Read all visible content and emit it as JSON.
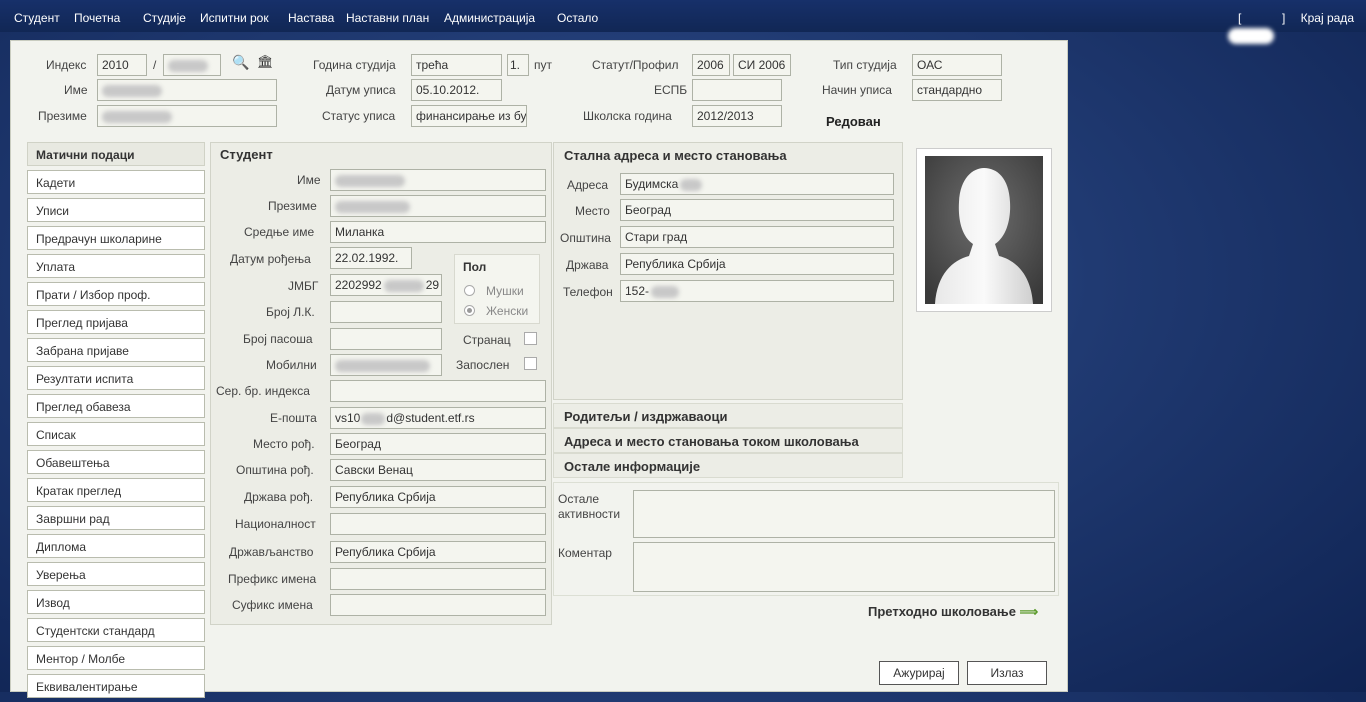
{
  "menu": {
    "items": [
      "Студент",
      "Почетна",
      "Студије",
      "Испитни рок",
      "Настава",
      "Наставни план",
      "Администрација",
      "Остало"
    ],
    "logout_left": "[",
    "logout_right": "]",
    "logout": "Крај рада"
  },
  "header": {
    "index_label": "Индекс",
    "index_year": "2010",
    "index_sep": "/",
    "ime_label": "Име",
    "prezime_label": "Презиме",
    "godina_label": "Година студија",
    "godina_value": "трећа",
    "put_num": "1.",
    "put_label": "пут",
    "datum_upisa_label": "Датум уписа",
    "datum_upisa": "05.10.2012.",
    "status_upisa_label": "Статус уписа",
    "status_upisa": "финансирање из буџ",
    "statut_label": "Статут/Профил",
    "statut_year": "2006",
    "profil": "СИ 2006",
    "espb_label": "ЕСПБ",
    "espb": "",
    "skolska_label": "Школска година",
    "skolska": "2012/2013",
    "tip_label": "Тип студија",
    "tip": "ОАС",
    "nacin_label": "Начин уписа",
    "nacin": "стандардно",
    "redovan": "Редован"
  },
  "sidebar": {
    "items": [
      "Матични подаци",
      "Кадети",
      "Уписи",
      "Предрачун школарине",
      "Уплата",
      "Прати / Избор проф.",
      "Преглед пријава",
      "Забрана пријаве",
      "Резултати испита",
      "Преглед обавеза",
      "Списак",
      "Обавештења",
      "Кратак преглед",
      "Завршни рад",
      "Диплома",
      "Уверења",
      "Извод",
      "Студентски стандард",
      "Ментор / Молбе",
      "Еквивалентирање"
    ]
  },
  "student": {
    "title": "Студент",
    "labels": {
      "ime": "Име",
      "prezime": "Презиме",
      "srednje": "Средње име",
      "datum": "Датум рођења",
      "jmbg": "ЈМБГ",
      "lk": "Број Л.К.",
      "pasos": "Број пасоша",
      "mob": "Мобилни",
      "ser": "Сер. бр. индекса",
      "email": "Е-пошта",
      "mesto": "Место рођ.",
      "opstina": "Општина рођ.",
      "drzava": "Држава рођ.",
      "nac": "Националност",
      "drzavljanstvo": "Држављанство",
      "prefiks": "Префикс имена",
      "sufiks": "Суфикс имена"
    },
    "srednje": "Миланка",
    "datum": "22.02.1992.",
    "jmbg_a": "2202992",
    "jmbg_b": "29",
    "email_a": "vs10",
    "email_b": "d@student.etf.rs",
    "mesto": "Београд",
    "opstina": "Савски Венац",
    "drzava": "Република Србија",
    "drzavljanstvo": "Република Србија",
    "pol_title": "Пол",
    "male": "Мушки",
    "female": "Женски",
    "stranac": "Странац",
    "zaposlen": "Запослен"
  },
  "address": {
    "title": "Стална адреса и место становања",
    "adresa_label": "Адреса",
    "adresa": "Будимска",
    "mesto_label": "Место",
    "mesto": "Београд",
    "opstina_label": "Општина",
    "opstina": "Стари град",
    "drzava_label": "Држава",
    "drzava": "Република Србија",
    "telefon_label": "Телефон",
    "telefon": "152-"
  },
  "accordion": [
    "Родитељи / издржаваоци",
    "Адреса и место становања током школовања",
    "Остале информације"
  ],
  "notes": {
    "ostale_label_1": "Остале",
    "ostale_label_2": "активности",
    "komentar_label": "Коментар"
  },
  "prev_link": "Претходно школовање",
  "buttons": {
    "update": "Ажурирај",
    "exit": "Излаз"
  }
}
